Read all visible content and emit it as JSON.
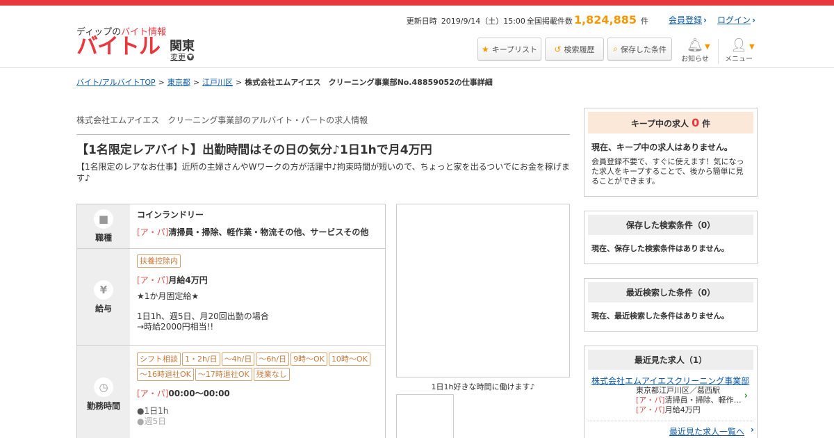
{
  "header": {
    "logo_sub_prefix": "ディップの",
    "logo_sub_accent": "バイト情報",
    "logo_main": "バイトル",
    "region": "関東",
    "region_change": "変更",
    "update_label": "更新日時",
    "update_datetime": "2019/9/14（土）15:00",
    "listing_label": "全国掲載件数",
    "listing_count": "1,824,885",
    "listing_unit": "件",
    "register_link": "会員登録",
    "login_link": "ログイン",
    "keep_list": "キープリスト",
    "history": "検索履歴",
    "saved_conditions": "保存した条件",
    "notifications": "お知らせ",
    "menu": "メニュー"
  },
  "breadcrumb": {
    "items": [
      "バイト/アルバイトTOP",
      "東京都",
      "江戸川区"
    ],
    "current": "株式会社エムアイエス　クリーニング事業部No.48859052の仕事詳細"
  },
  "job": {
    "company_line": "株式会社エムアイエス　クリーニング事業部のアルバイト・パートの求人情報",
    "title": "【1名限定レアバイト】出勤時間はその日の気分♪1日1hで月4万円",
    "description": "【1名限定のレアなお仕事】近所の主婦さんやWワークの方が活躍中♪拘束時間が短いので、ちょっと家を出るついでにお金を稼げます♪"
  },
  "details": {
    "occupation": {
      "label": "職種",
      "place": "コインランドリー",
      "type_prefix": "[ア・パ]",
      "text": "清掃員・掃除、軽作業・物流その他、サービスその他"
    },
    "salary": {
      "label": "給与",
      "tag": "扶養控除内",
      "type_prefix": "[ア・パ]",
      "amount": "月給4万円",
      "note1": "★1か月固定給★",
      "note2": "1日1h、週5日、月20回出勤の場合",
      "note3": "→時給2000円相当!!"
    },
    "hours": {
      "label": "勤務時間",
      "tags": [
        "シフト相談",
        "1・2h/日",
        "～4h/日",
        "～6h/日",
        "9時～OK",
        "10時～OK",
        "～16時退社OK",
        "～17時退社OK",
        "残業なし"
      ],
      "type_prefix": "[ア・パ]",
      "time": "00:00～00:00",
      "bullet1": "●1日1h",
      "bullet2": "●週5日"
    }
  },
  "photo": {
    "caption": "1日1h好きな時間に働けます♪"
  },
  "sidebar": {
    "keep": {
      "title": "キープ中の求人",
      "count": "0",
      "unit": "件",
      "empty": "現在、キープ中の求人はありません。",
      "note": "会員登録不要で、すぐに使えます！気になった求人をキープすることで、後から簡単に見ることができます。"
    },
    "saved": {
      "title": "保存した検索条件（0）",
      "empty": "現在、保存した検索条件はありません。"
    },
    "recent_search": {
      "title": "最近検索した条件（0）",
      "empty": "現在、最近検索した条件はありません。"
    },
    "recent_viewed": {
      "title": "最近見た求人（1）",
      "company": "株式会社エムアイエスクリーニング事業部",
      "location": "東京都江戸川区／葛西駅",
      "type_prefix": "[ア・パ]",
      "job": "清掃員・掃除、軽作…",
      "salary": "月給4万円",
      "more_link": "最近見た求人一覧へ"
    }
  },
  "colors": {
    "brand_red": "#e8383d",
    "accent_orange": "#f39800",
    "link_blue": "#0e5aa6"
  }
}
